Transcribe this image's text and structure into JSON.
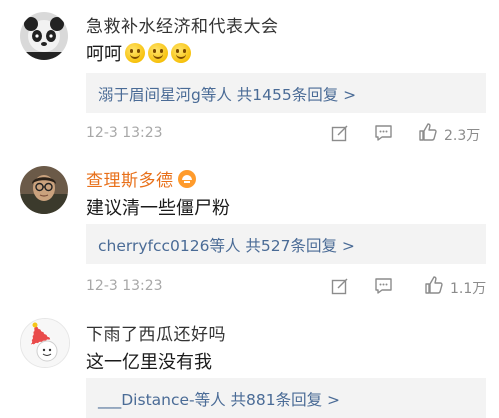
{
  "comments": [
    {
      "username": "急救补水经济和代表大会",
      "username_color": "#333333",
      "text": "呵呵",
      "emoji": [
        "smile-emoji",
        "smile-emoji",
        "smile-emoji"
      ],
      "reply_summary": "溺于眉间星河g等人  共1455条回复 >",
      "timestamp": "12-3 13:23",
      "likes": "2.3万"
    },
    {
      "username": "查理斯多德",
      "username_color": "#e8701a",
      "badge": "vip-badge-icon",
      "text": "建议清一些僵尸粉",
      "reply_summary": "cherryfcc0126等人  共527条回复 >",
      "timestamp": "12-3 13:23",
      "likes": "1.1万"
    },
    {
      "username": "下雨了西瓜还好吗",
      "username_color": "#333333",
      "text": "这一亿里没有我",
      "reply_summary": "___Distance-等人  共881条回复 >"
    }
  ],
  "icons": {
    "share": "share-icon",
    "comment": "comment-icon",
    "like": "thumbs-up-icon"
  }
}
